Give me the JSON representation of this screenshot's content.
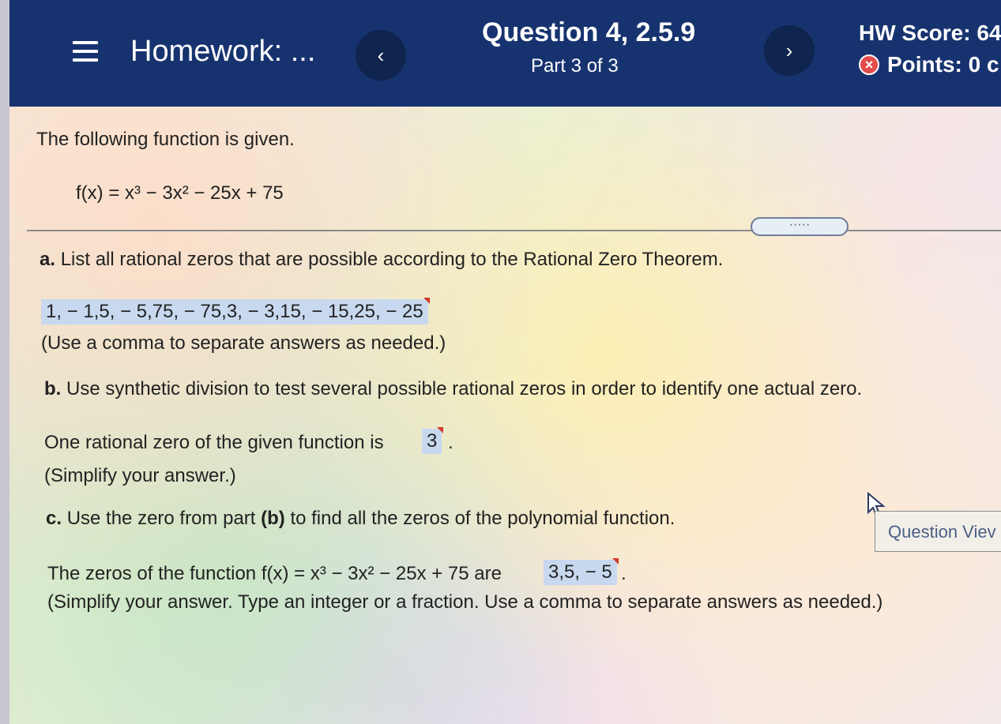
{
  "header": {
    "menu_icon": "hamburger-menu-icon",
    "title": "Homework: ...",
    "prev_icon": "‹",
    "next_icon": "›",
    "question_title": "Question 4, 2.5.9",
    "part": "Part 3 of 3",
    "hw_score": "HW Score: 64",
    "points": "Points: 0 c",
    "x_icon": "×"
  },
  "problem": {
    "intro": "The following function is given.",
    "function": "f(x) = x³ − 3x² − 25x + 75",
    "expand": "·····"
  },
  "part_a": {
    "label": "a.",
    "question": "List all rational zeros that are possible according to the Rational Zero Theorem.",
    "answer": "1, − 1,5, − 5,75, − 75,3, − 3,15, − 15,25, − 25",
    "hint": "(Use a comma to separate answers as needed.)"
  },
  "part_b": {
    "label": "b.",
    "question": "Use synthetic division to test several possible rational zeros in order to identify one actual zero.",
    "answer_prefix": "One rational zero of the given function is",
    "answer": "3",
    "answer_suffix": ".",
    "hint": "(Simplify your answer.)"
  },
  "part_c": {
    "label": "c.",
    "question_pre": "Use the zero from part",
    "question_bold": "(b)",
    "question_post": "to find all the zeros of the polynomial function.",
    "answer_prefix": "The zeros of the function f(x) = x³ − 3x² − 25x + 75 are",
    "answer": "3,5, − 5",
    "answer_suffix": ".",
    "hint": "(Simplify your answer. Type an integer or a fraction. Use a comma to separate answers as needed.)"
  },
  "question_view_button": "Question Viev"
}
